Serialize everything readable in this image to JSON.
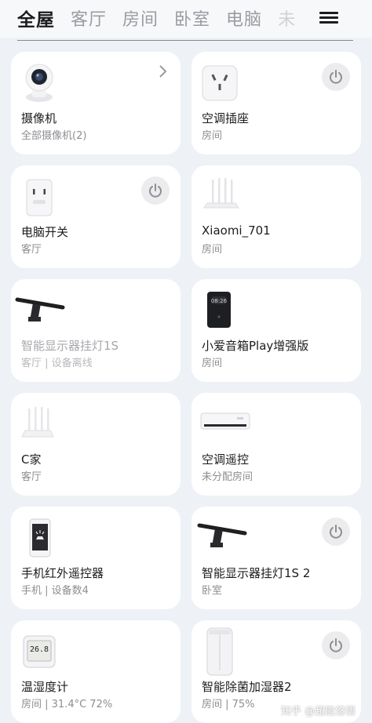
{
  "tabs": [
    "全屋",
    "客厅",
    "房间",
    "卧室",
    "电脑",
    "未"
  ],
  "devices": [
    {
      "name": "摄像机",
      "sub": "全部摄像机(2)",
      "icon": "camera-icon"
    },
    {
      "name": "空调插座",
      "sub": "房间",
      "icon": "ac-socket-icon"
    },
    {
      "name": "电脑开关",
      "sub": "客厅",
      "icon": "socket-icon"
    },
    {
      "name": "Xiaomi_701",
      "sub": "房间",
      "icon": "router-icon"
    },
    {
      "name": "智能显示器挂灯1S",
      "sub": "客厅 | 设备离线",
      "icon": "monitor-light-icon"
    },
    {
      "name": "小爱音箱Play增强版",
      "sub": "房间",
      "icon": "speaker-icon"
    },
    {
      "name": "C家",
      "sub": "客厅",
      "icon": "router-icon"
    },
    {
      "name": "空调遥控",
      "sub": "未分配房间",
      "icon": "ac-unit-icon"
    },
    {
      "name": "手机红外遥控器",
      "sub": "手机 | 设备数4",
      "icon": "phone-icon"
    },
    {
      "name": "智能显示器挂灯1S 2",
      "sub": "卧室",
      "icon": "monitor-light-icon"
    },
    {
      "name": "温湿度计",
      "sub": "房间 | 31.4°C 72%",
      "icon": "thermometer-icon"
    },
    {
      "name": "智能除菌加湿器2",
      "sub": "房间 | 75%",
      "icon": "humidifier-icon"
    }
  ],
  "display": {
    "thermo_reading": "26.8"
  },
  "watermark": "知乎 @超能悠悟"
}
